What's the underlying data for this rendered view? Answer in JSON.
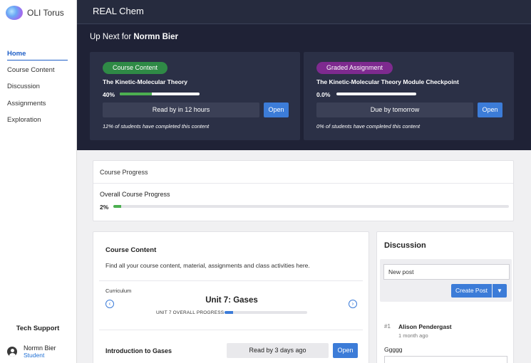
{
  "app": {
    "logo_text": "OLI Torus",
    "course_title": "REAL Chem"
  },
  "sidebar": {
    "items": [
      {
        "label": "Home",
        "active": true
      },
      {
        "label": "Course Content"
      },
      {
        "label": "Discussion"
      },
      {
        "label": "Assignments"
      },
      {
        "label": "Exploration"
      }
    ],
    "tech_support": "Tech Support",
    "user": {
      "name": "Normn Bier",
      "role": "Student"
    }
  },
  "hero": {
    "title_prefix": "Up Next for",
    "user_name": "Normn Bier",
    "cards": [
      {
        "badge": "Course Content",
        "title": "The Kinetic-Molecular Theory",
        "progress_text": "40%",
        "progress": 40,
        "status": "Read by in 12 hours",
        "open_label": "Open",
        "note": "12% of students have completed this content"
      },
      {
        "badge": "Graded Assignment",
        "title": "The Kinetic-Molecular Theory Module Checkpoint",
        "progress_text": "0.0%",
        "progress": 0,
        "status": "Due by tomorrow",
        "open_label": "Open",
        "note": "0% of students have completed this content"
      }
    ]
  },
  "course_progress": {
    "header": "Course Progress",
    "label": "Overall Course Progress",
    "percent_text": "2%",
    "percent": 2
  },
  "course_content": {
    "title": "Course Content",
    "description": "Find all your course content, material, assignments and class activities here.",
    "curriculum_label": "Curriculum",
    "unit_title": "Unit 7: Gases",
    "unit_progress_label": "UNIT 7 OVERALL PROGRESS",
    "unit_progress": 10,
    "row": {
      "title": "Introduction to Gases",
      "status": "Read by 3 days ago",
      "open_label": "Open"
    }
  },
  "discussion": {
    "title": "Discussion",
    "new_post_value": "New post",
    "create_post_label": "Create Post",
    "posts": [
      {
        "index": "#1",
        "author": "Alison Pendergast",
        "time": "1 month ago",
        "body": "Ggggg"
      }
    ]
  },
  "icons": {
    "prev_unit": "chevron-left-circle-icon",
    "next_unit": "chevron-right-circle-icon",
    "user": "user-avatar-icon",
    "dropdown": "chevron-down-icon"
  },
  "colors": {
    "header_bg": "#262b3e",
    "hero_bg": "#1f2236",
    "card_bg": "#2b3046",
    "primary": "#3c7cd8",
    "progress_green": "#4caf50",
    "badge_course_content": "#2f8a46",
    "badge_graded_assignment": "#7e2a8f"
  }
}
